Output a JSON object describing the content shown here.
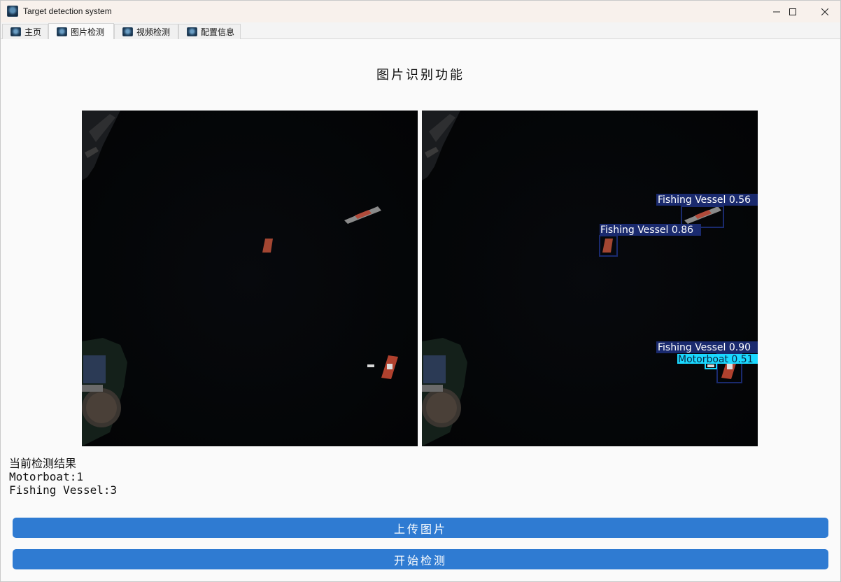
{
  "window": {
    "title": "Target detection system",
    "controls": [
      "minimize",
      "maximize",
      "close"
    ]
  },
  "tabs": [
    {
      "label": "主页",
      "icon": "app-logo-icon",
      "active": false
    },
    {
      "label": "图片检测",
      "icon": "app-logo-icon",
      "active": true
    },
    {
      "label": "视频检测",
      "icon": "app-logo-icon",
      "active": false
    },
    {
      "label": "配置信息",
      "icon": "app-logo-icon",
      "active": false
    }
  ],
  "main": {
    "title": "图片识别功能",
    "detections": [
      {
        "label": "Fishing Vessel 0.56",
        "class": "Fishing Vessel",
        "confidence": 0.56,
        "color": "#1a2a6e"
      },
      {
        "label": "Fishing Vessel 0.86",
        "class": "Fishing Vessel",
        "confidence": 0.86,
        "color": "#1a2a6e"
      },
      {
        "label": "Fishing Vessel 0.90",
        "class": "Fishing Vessel",
        "confidence": 0.9,
        "color": "#1a2a6e"
      },
      {
        "label": "Motorboat 0.51",
        "class": "Motorboat",
        "confidence": 0.51,
        "color": "#1ad8ff"
      }
    ],
    "results": {
      "heading": "当前检测结果",
      "lines": [
        "Motorboat:1",
        "Fishing Vessel:3"
      ]
    },
    "buttons": {
      "upload": "上传图片",
      "detect": "开始检测",
      "color": "#2f7bd2"
    }
  }
}
